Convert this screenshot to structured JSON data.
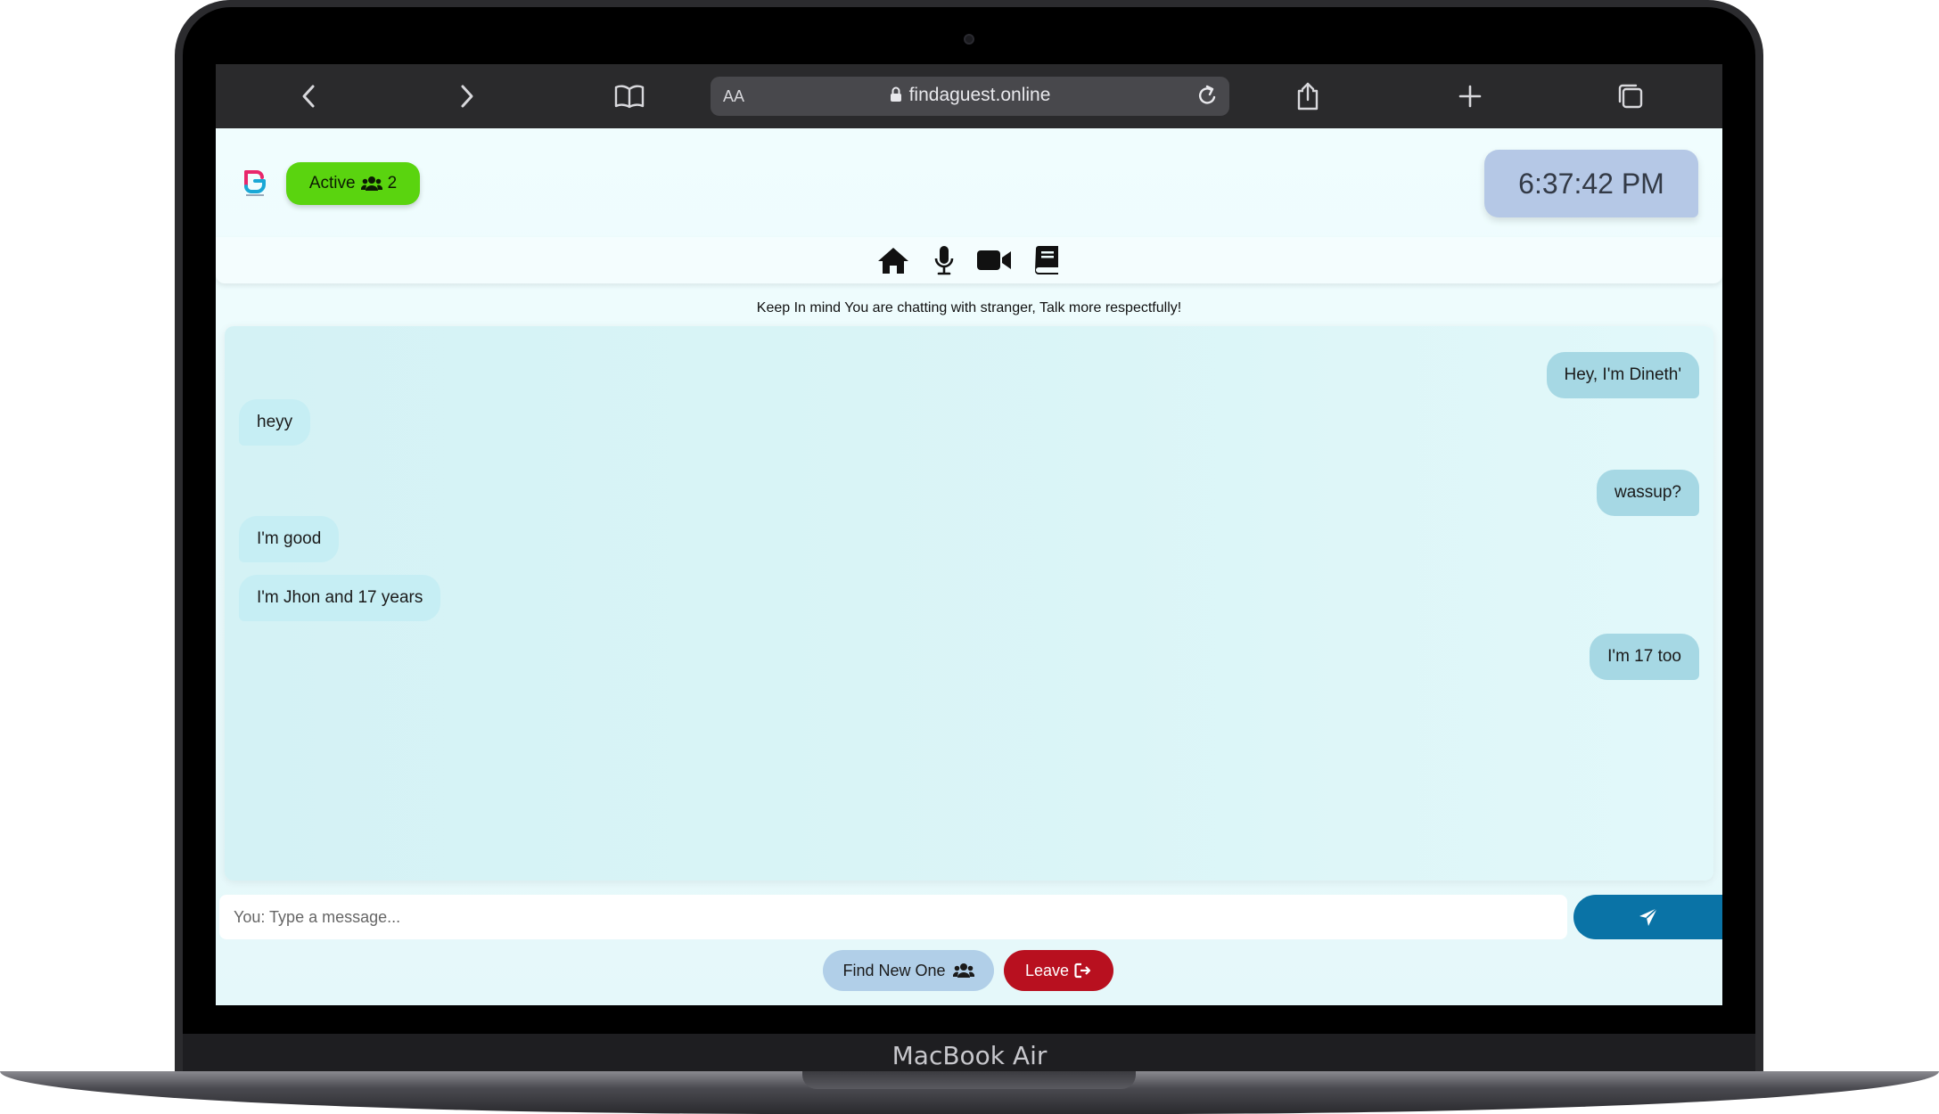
{
  "device": {
    "brand_label": "MacBook Air"
  },
  "browser": {
    "url": "findaguest.online",
    "reader_label": "AA",
    "icons": [
      "back-icon",
      "forward-icon",
      "bookmarks-icon",
      "lock-icon",
      "reload-icon",
      "share-icon",
      "new-tab-icon",
      "tabs-icon"
    ]
  },
  "header": {
    "active_label": "Active",
    "active_count": "2",
    "clock": "6:37:42 PM"
  },
  "nav": {
    "icons": [
      "home-icon",
      "microphone-icon",
      "video-icon",
      "book-icon"
    ]
  },
  "notice": "Keep In mind You are chatting with stranger, Talk more respectfully!",
  "messages": [
    {
      "from": "me",
      "text": "Hey, I'm Dineth'"
    },
    {
      "from": "them",
      "text": "heyy"
    },
    {
      "from": "me",
      "text": "wassup?"
    },
    {
      "from": "them",
      "text": "I'm good"
    },
    {
      "from": "them",
      "text": "I'm Jhon and 17 years"
    },
    {
      "from": "me",
      "text": "I'm 17 too"
    }
  ],
  "composer": {
    "placeholder": "You: Type a message..."
  },
  "actions": {
    "find_label": "Find New One",
    "leave_label": "Leave"
  },
  "colors": {
    "active": "#5ad40f",
    "clock_bg": "#b5c8e6",
    "send": "#0a73a6",
    "find": "#b1cfe8",
    "leave": "#b8101f",
    "bubble_me": "#a6d8e4",
    "bubble_them": "#c6eef4"
  }
}
